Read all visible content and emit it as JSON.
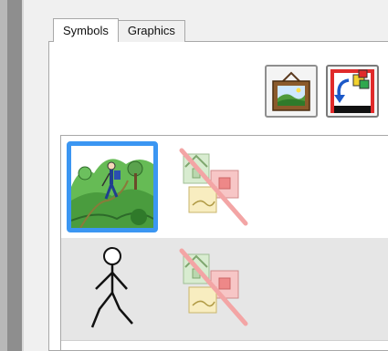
{
  "tabs": [
    {
      "label": "Symbols",
      "active": true
    },
    {
      "label": "Graphics",
      "active": false
    }
  ],
  "toolbar": {
    "picture_button_icon": "framed-landscape-icon",
    "swap_button_icon": "swap-arrows-icon"
  },
  "symbols": [
    {
      "symbol": "hiker-on-trail-icon",
      "graphic": "no-graphics-icon",
      "selected": true
    },
    {
      "symbol": "walking-stick-figure-icon",
      "graphic": "no-graphics-icon",
      "selected": false
    }
  ],
  "colors": {
    "selection": "#3b96f2",
    "alt_row": "#e6e6e6",
    "no_graphic_slash": "#f3a5a5"
  }
}
